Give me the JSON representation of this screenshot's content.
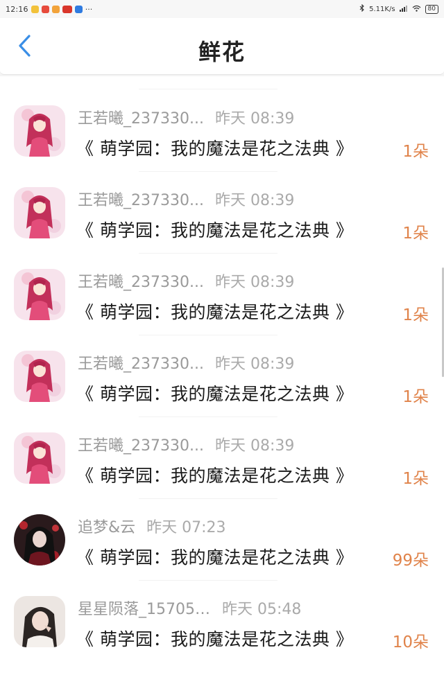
{
  "status_bar": {
    "time": "12:16",
    "more_indicator": "···",
    "network_speed": "5.11K/s",
    "battery": "80"
  },
  "header": {
    "title": "鲜花"
  },
  "gifts": [
    {
      "user": "王若曦_237330...",
      "time": "昨天 08:39",
      "book": "《 萌学园：我的魔法是花之法典 》",
      "count": "1朵",
      "avatar": "anime-girl"
    },
    {
      "user": "王若曦_237330...",
      "time": "昨天 08:39",
      "book": "《 萌学园：我的魔法是花之法典 》",
      "count": "1朵",
      "avatar": "anime-girl"
    },
    {
      "user": "王若曦_237330...",
      "time": "昨天 08:39",
      "book": "《 萌学园：我的魔法是花之法典 》",
      "count": "1朵",
      "avatar": "anime-girl"
    },
    {
      "user": "王若曦_237330...",
      "time": "昨天 08:39",
      "book": "《 萌学园：我的魔法是花之法典 》",
      "count": "1朵",
      "avatar": "anime-girl"
    },
    {
      "user": "王若曦_237330...",
      "time": "昨天 08:39",
      "book": "《 萌学园：我的魔法是花之法典 》",
      "count": "1朵",
      "avatar": "anime-girl"
    },
    {
      "user": "追梦&云",
      "time": "昨天 07:23",
      "book": "《 萌学园：我的魔法是花之法典 》",
      "count": "99朵",
      "avatar": "dark-portrait"
    },
    {
      "user": "星星陨落_157056...",
      "time": "昨天 05:48",
      "book": "《 萌学园：我的魔法是花之法典 》",
      "count": "10朵",
      "avatar": "photo-portrait"
    }
  ],
  "colors": {
    "accent_back": "#3a8ee6",
    "flower_count": "#e0834a",
    "username": "#9a9a9a"
  }
}
